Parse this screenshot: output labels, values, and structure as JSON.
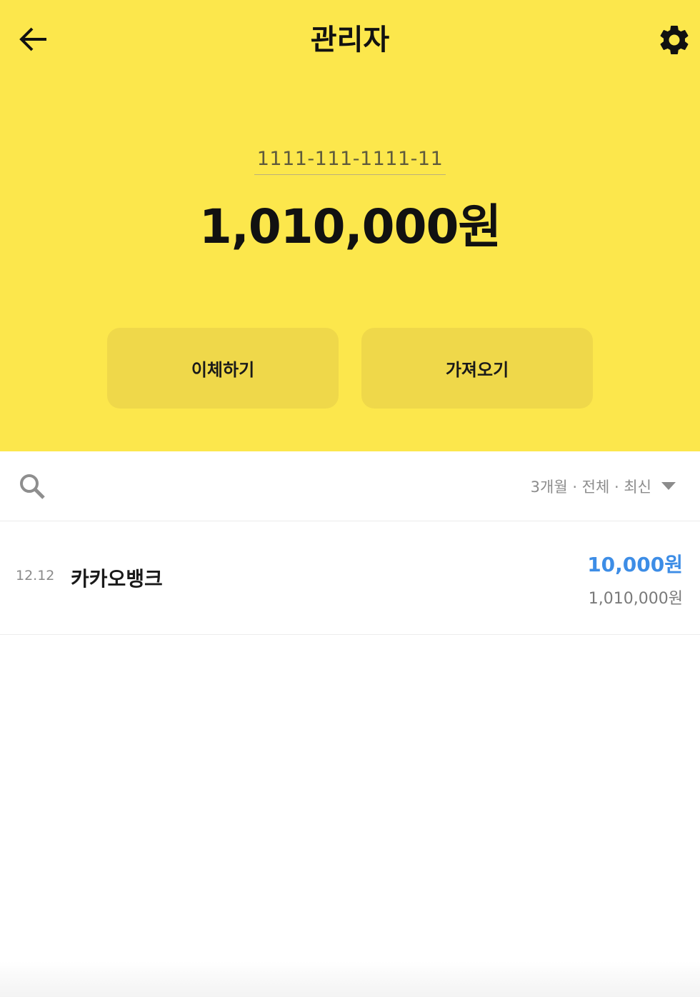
{
  "header": {
    "title": "관리자",
    "back_icon": "arrow-left-icon",
    "settings_icon": "gear-icon"
  },
  "account": {
    "number": "1111-111-1111-11",
    "balance": "1,010,000원"
  },
  "actions": {
    "transfer_label": "이체하기",
    "fetch_label": "가져오기"
  },
  "filter": {
    "search_icon": "search-icon",
    "selected": "3개월 · 전체 · 최신",
    "dropdown_icon": "caret-down-icon"
  },
  "transactions": [
    {
      "date": "12.12",
      "name": "카카오뱅크",
      "amount": "10,000원",
      "balance_after": "1,010,000원"
    }
  ],
  "colors": {
    "brand_yellow": "#fce74c",
    "button_yellow": "#efd84a",
    "deposit_blue": "#3d8de6"
  }
}
